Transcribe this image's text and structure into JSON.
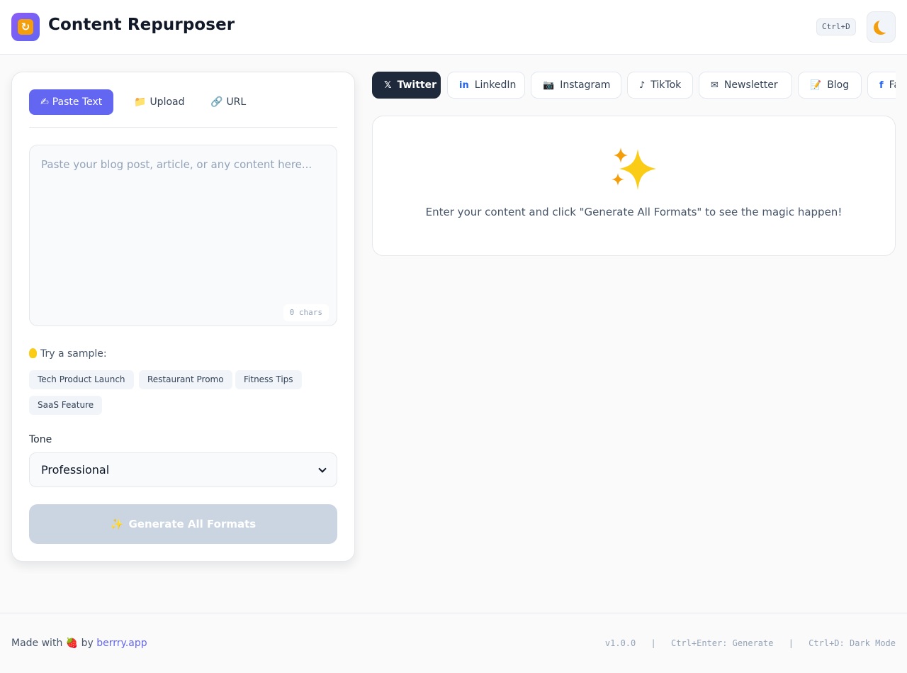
{
  "header": {
    "title": "Content Repurposer",
    "shortcut_hint": "Ctrl+D",
    "theme_toggle_icon": "moon-icon"
  },
  "input_tabs": [
    {
      "icon": "✍",
      "label": "Paste Text",
      "active": true
    },
    {
      "icon": "📁",
      "label": "Upload",
      "active": false
    },
    {
      "icon": "🔗",
      "label": "URL",
      "active": false
    }
  ],
  "editor": {
    "placeholder": "Paste your blog post, article, or any content here...",
    "value": "",
    "char_count": "0 chars"
  },
  "samples": {
    "label": "Try a sample:",
    "items": [
      "Tech Product Launch",
      "Restaurant Promo",
      "Fitness Tips",
      "SaaS Feature"
    ]
  },
  "tone": {
    "label": "Tone",
    "selected": "Professional"
  },
  "generate_button": {
    "label": "Generate All Formats",
    "icon": "✨",
    "disabled": true
  },
  "platform_tabs": [
    {
      "icon": "𝕏",
      "label": "Twitter",
      "active": true
    },
    {
      "icon": "in",
      "label": "LinkedIn",
      "active": false
    },
    {
      "icon": "📷",
      "label": "Instagram",
      "active": false
    },
    {
      "icon": "♪",
      "label": "TikTok",
      "active": false
    },
    {
      "icon": "✉",
      "label": "Newsletter",
      "active": false
    },
    {
      "icon": "📝",
      "label": "Blog",
      "active": false
    },
    {
      "icon": "f",
      "label": "Facebook",
      "active": false
    }
  ],
  "output": {
    "icon": "sparkles-icon",
    "empty_message": "Enter your content and click \"Generate All Formats\" to see the magic happen!"
  },
  "footer": {
    "made_with": "Made with",
    "heart": "🍓",
    "by": "by",
    "link": "berrry.app",
    "version": "v1.0.0",
    "sep1": "|",
    "shortcut_generate": "Ctrl+Enter: Generate",
    "sep2": "|",
    "shortcut_dark": "Ctrl+D: Dark Mode"
  },
  "colors": {
    "accent": "#6366f1",
    "active_platform": "#1e293b",
    "disabled_button": "#cbd5e1"
  }
}
